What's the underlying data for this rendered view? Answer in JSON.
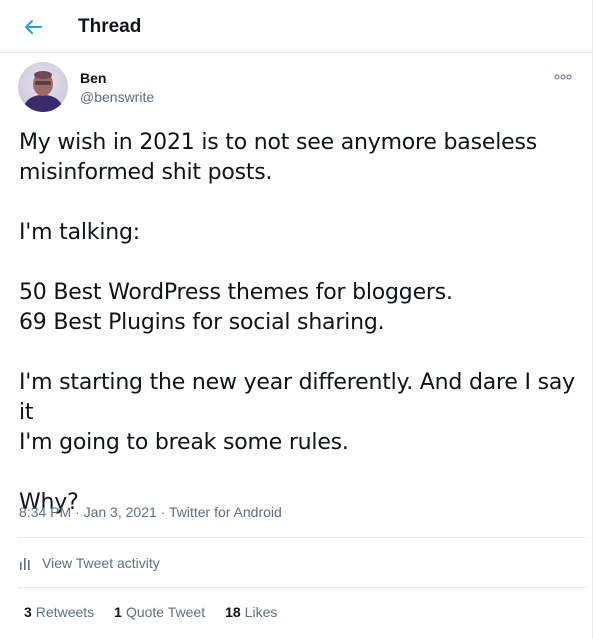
{
  "header": {
    "title": "Thread",
    "back_icon": "back-arrow-icon",
    "accent_color": "#1da1f2"
  },
  "author": {
    "name": "Ben",
    "handle": "@benswrite",
    "avatar_icon": "avatar"
  },
  "tweet": {
    "paragraphs": [
      [
        "My wish in 2021 is to not see anymore baseless",
        "misinformed shit posts."
      ],
      [
        "I'm talking:"
      ],
      [
        "50 Best WordPress themes for bloggers.",
        "69 Best Plugins for social sharing."
      ],
      [
        "I'm starting the new year differently. And dare I say it",
        "I'm going to break some rules."
      ],
      [
        "Why?"
      ]
    ],
    "time": "8:34 PM",
    "date": "Jan 3, 2021",
    "source": "Twitter for Android",
    "separator": " · "
  },
  "activity": {
    "label": "View Tweet activity",
    "icon": "bar-chart-icon"
  },
  "stats": {
    "retweets_count": "3",
    "retweets_label": "Retweets",
    "quotes_count": "1",
    "quotes_label": "Quote Tweet",
    "likes_count": "18",
    "likes_label": "Likes"
  }
}
